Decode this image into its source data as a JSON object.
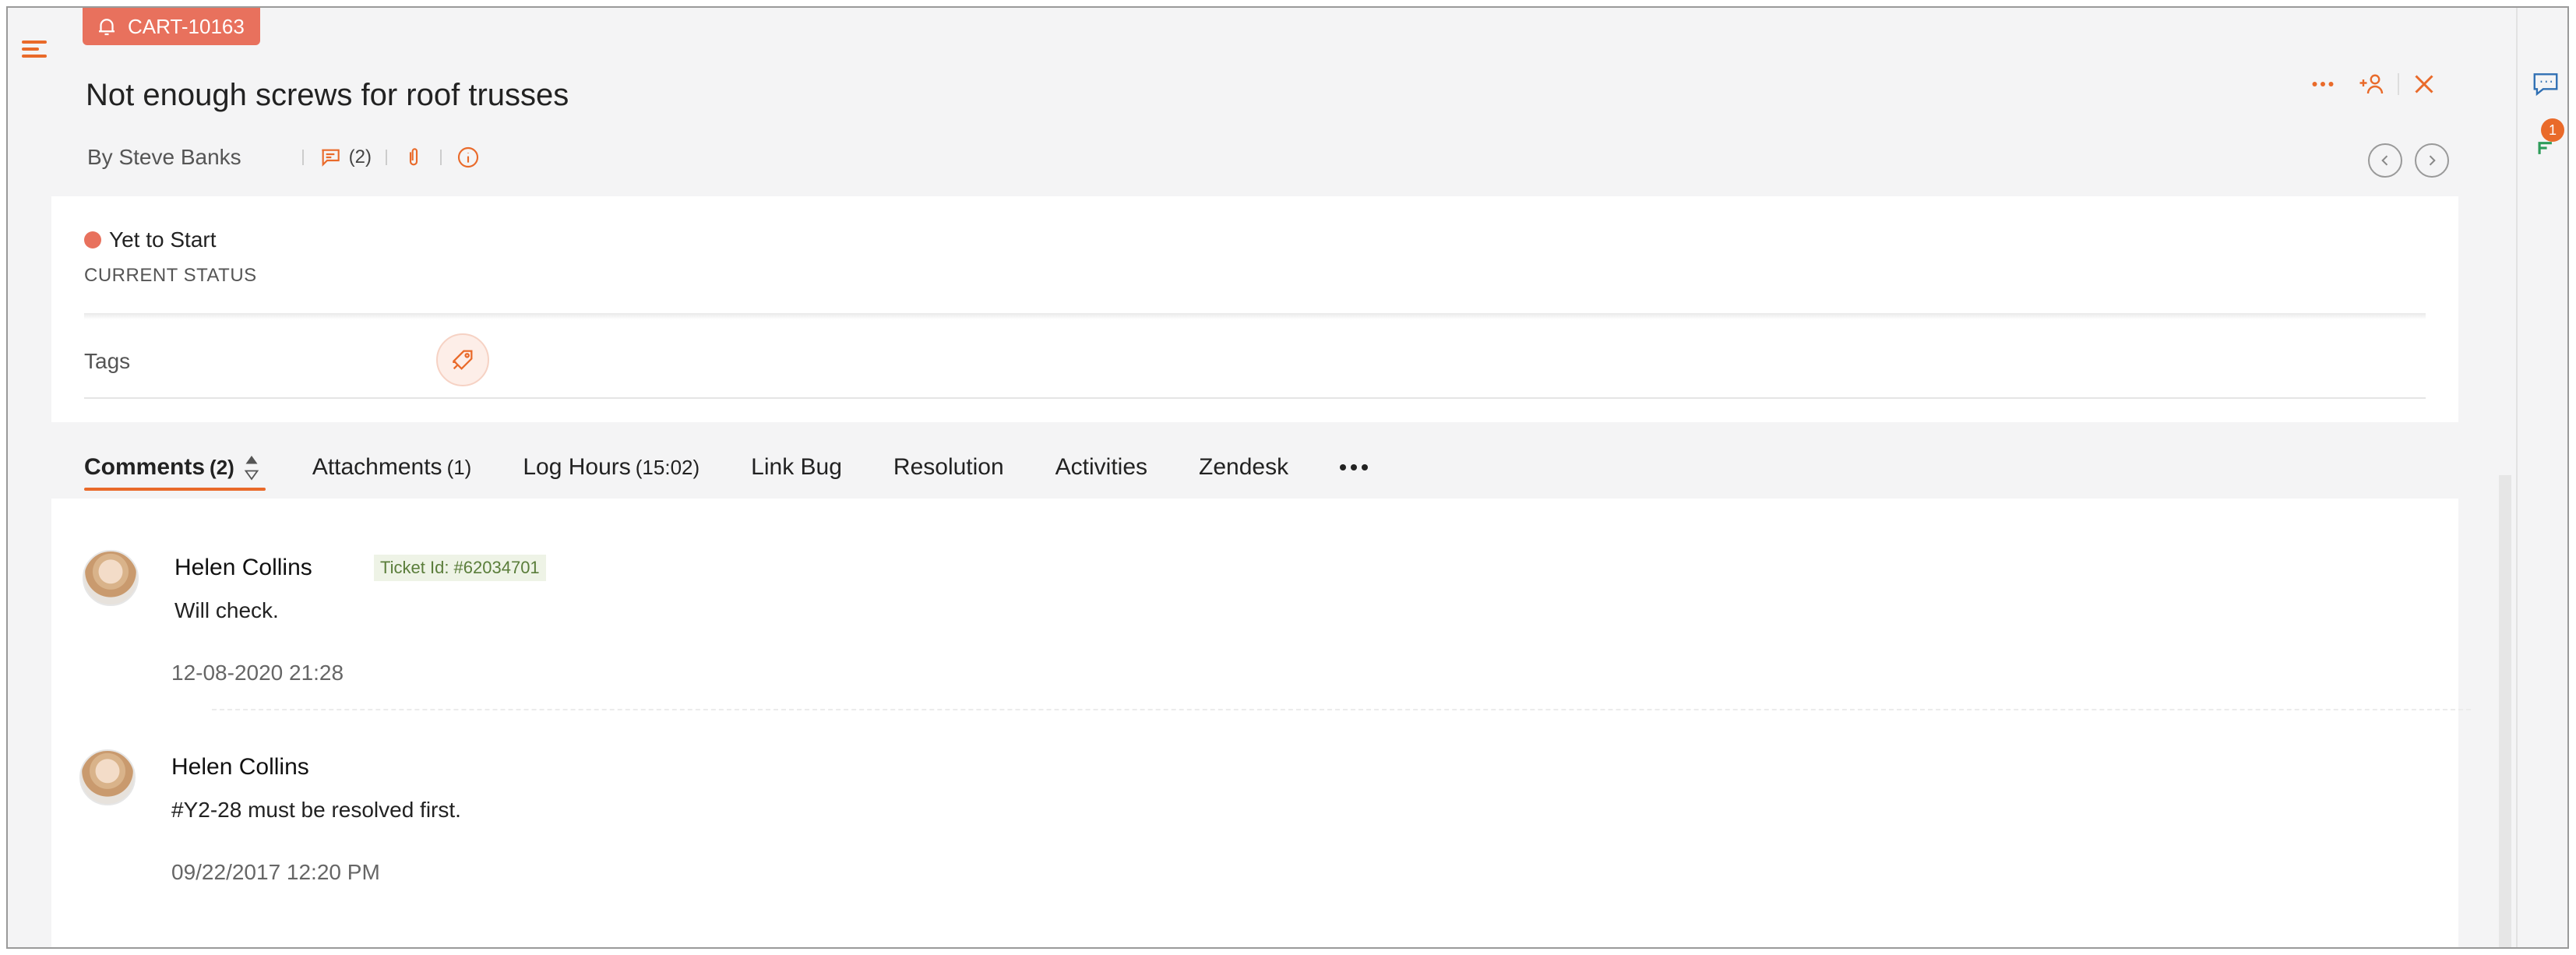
{
  "ticket": {
    "id": "CART-10163",
    "title": "Not enough screws for roof trusses",
    "author": "By Steve Banks",
    "comment_count": "(2)"
  },
  "status": {
    "value": "Yet to Start",
    "label": "CURRENT STATUS",
    "color": "#e8715d"
  },
  "tags": {
    "label": "Tags"
  },
  "tabs": [
    {
      "label": "Comments",
      "count": "(2)",
      "active": true
    },
    {
      "label": "Attachments",
      "count": "(1)"
    },
    {
      "label": "Log Hours",
      "count": "(15:02)"
    },
    {
      "label": "Link Bug",
      "count": ""
    },
    {
      "label": "Resolution",
      "count": ""
    },
    {
      "label": "Activities",
      "count": ""
    },
    {
      "label": "Zendesk",
      "count": ""
    }
  ],
  "comments": [
    {
      "name": "Helen Collins",
      "ticket_tag": "Ticket Id: #62034701",
      "text": "Will check.",
      "time": "12-08-2020 21:28"
    },
    {
      "name": "Helen Collins",
      "text": "#Y2-28 must be resolved first.",
      "time": "09/22/2017 12:20 PM"
    }
  ],
  "rail": {
    "notification_count": "1"
  },
  "colors": {
    "accent": "#e96a2a",
    "badge": "#e8715d",
    "ticket_tag_bg": "#eef3e6"
  },
  "icons": [
    "menu-icon",
    "bell-icon",
    "comment-icon",
    "paperclip-icon",
    "info-icon",
    "more-icon",
    "assign-user-icon",
    "close-icon",
    "chevron-left-icon",
    "chevron-right-icon",
    "tag-icon",
    "sort-icon",
    "chat-icon",
    "feed-icon"
  ]
}
